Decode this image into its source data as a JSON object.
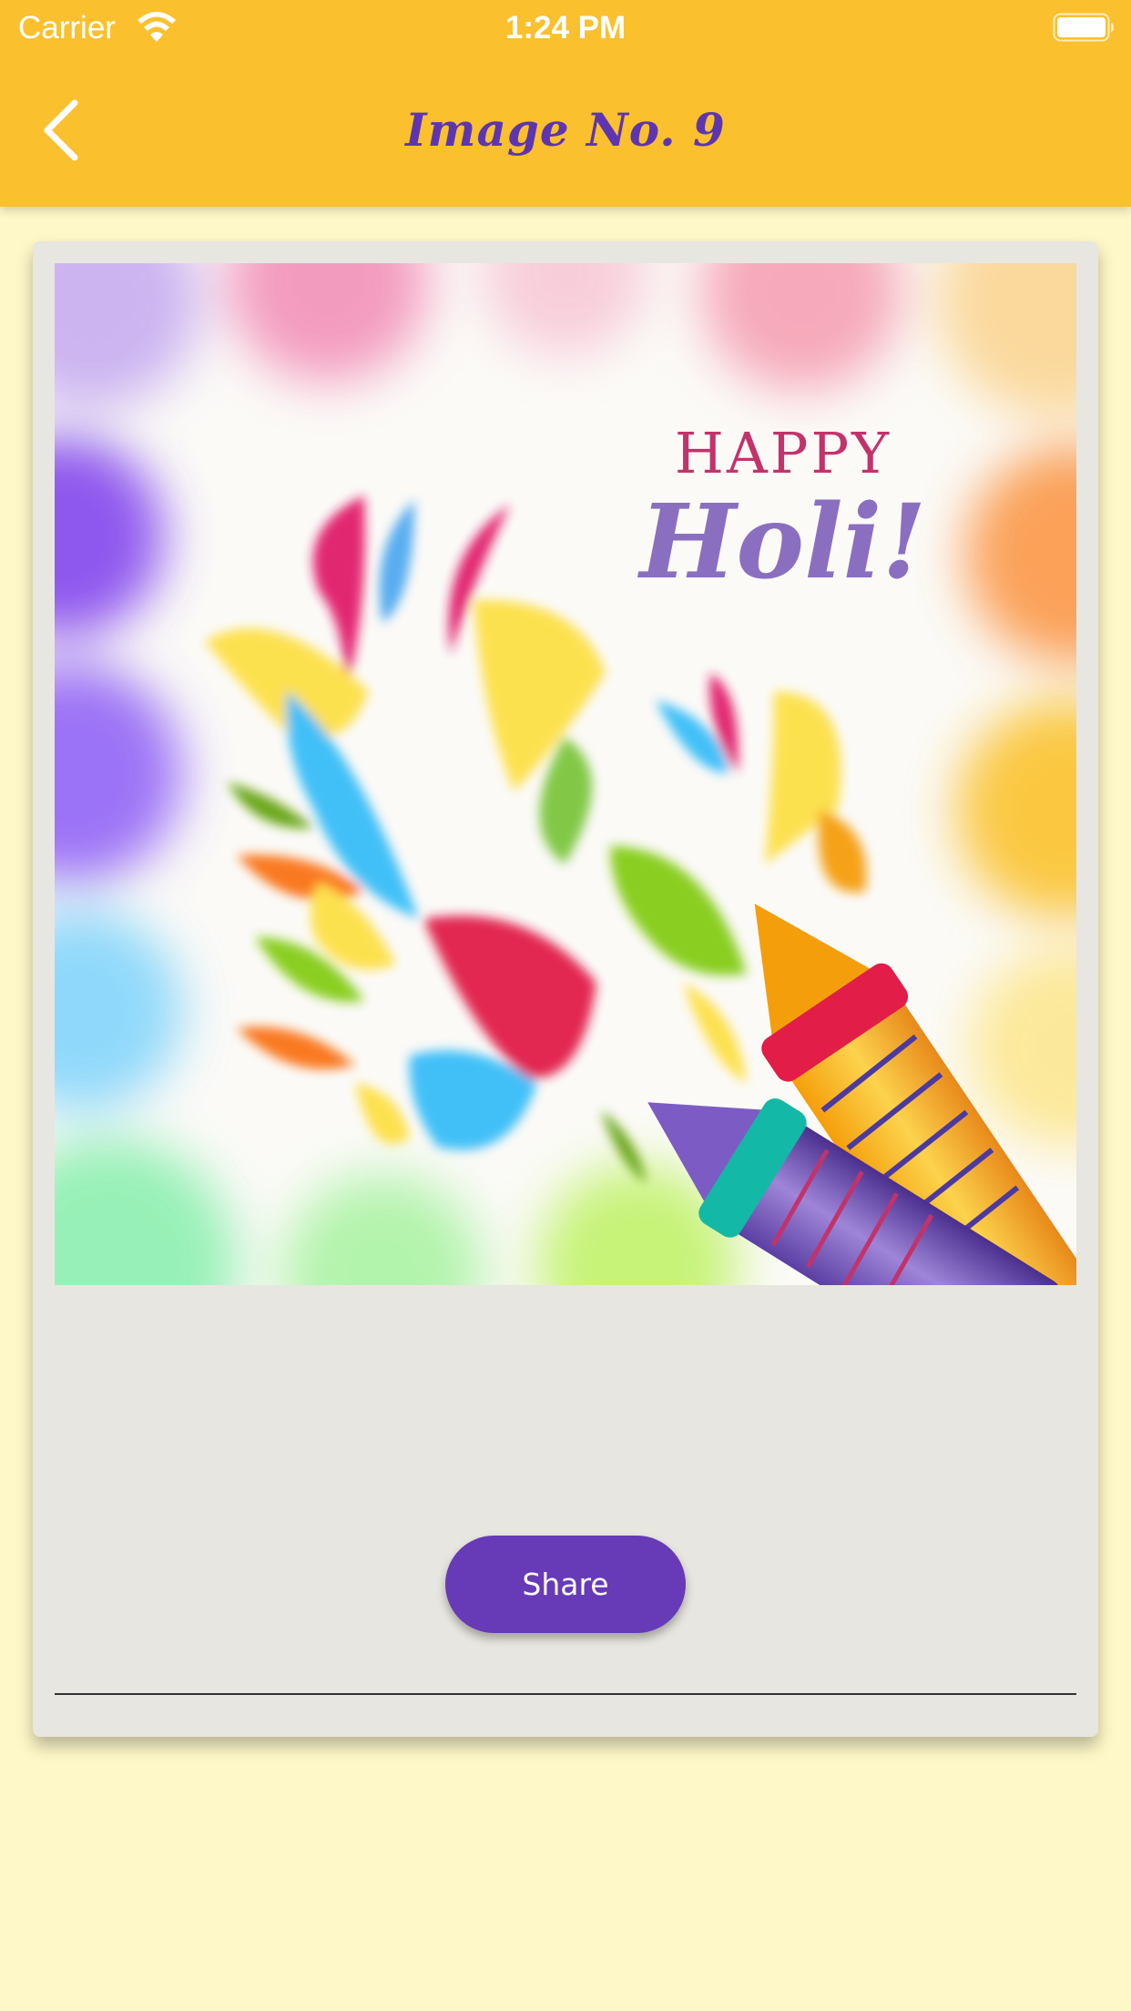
{
  "status_bar": {
    "carrier": "Carrier",
    "time": "1:24 PM",
    "wifi_icon": "wifi-icon",
    "battery_icon": "battery-icon"
  },
  "nav": {
    "title": "Image No. 9",
    "back_icon": "chevron-left-icon"
  },
  "image": {
    "greeting_line1": "HAPPY",
    "greeting_line2": "Holi!"
  },
  "actions": {
    "share_label": "Share"
  },
  "colors": {
    "nav_bar": "#fbc02d",
    "page_background": "#fef8c8",
    "card_background": "#e8e6e0",
    "title": "#5e35b1",
    "share_button": "#673ab7",
    "status_text": "#ffffff"
  }
}
